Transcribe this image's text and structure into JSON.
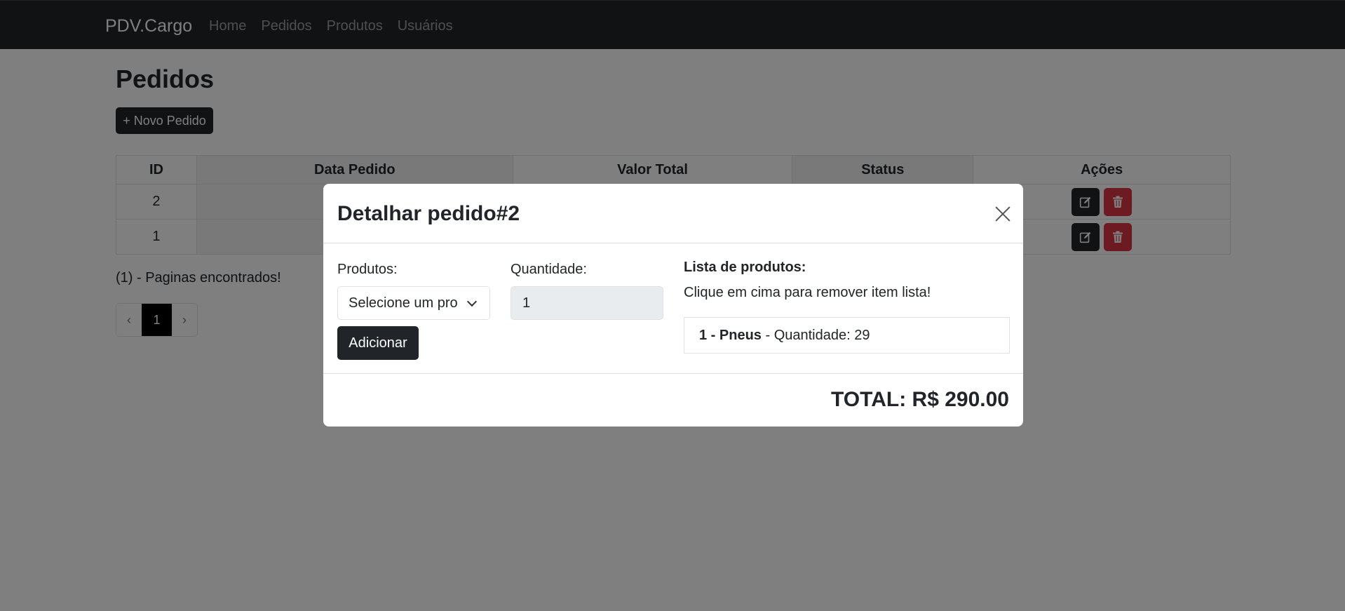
{
  "navbar": {
    "brand": "PDV.Cargo",
    "links": [
      "Home",
      "Pedidos",
      "Produtos",
      "Usuários"
    ]
  },
  "page": {
    "title": "Pedidos",
    "new_button": "+ Novo Pedido",
    "table": {
      "headers": [
        "ID",
        "Data Pedido",
        "Valor Total",
        "Status",
        "Ações"
      ],
      "rows": [
        {
          "id": "2"
        },
        {
          "id": "1"
        }
      ]
    },
    "pages_found": "(1) - Paginas encontrados!",
    "pagination": {
      "prev": "‹",
      "current": "1",
      "next": "›"
    }
  },
  "modal": {
    "title": "Detalhar pedido#2",
    "products_label": "Produtos:",
    "products_select_value": "Selecione um produto",
    "quantity_label": "Quantidade:",
    "quantity_value": "1",
    "add_button": "Adicionar",
    "list_title": "Lista de produtos:",
    "list_hint": "Clique em cima para remover item lista!",
    "items": [
      {
        "name": "1 - Pneus",
        "detail": " - Quantidade: 29"
      }
    ],
    "total": "TOTAL: R$ 290.00"
  },
  "colors": {
    "dark": "#212529",
    "danger": "#dc3545",
    "backdrop": "rgba(0,0,0,0.5)"
  }
}
